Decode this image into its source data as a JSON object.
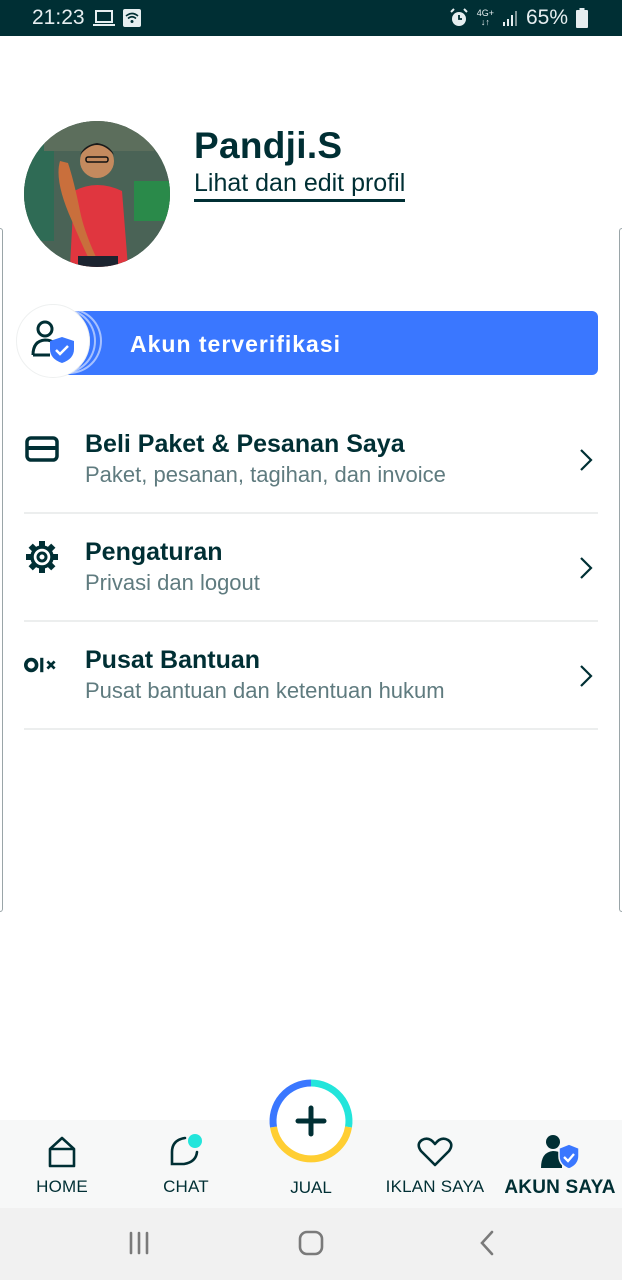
{
  "status_bar": {
    "time": "21:23",
    "battery": "65%",
    "network": "4G+",
    "icons": [
      "laptop-icon",
      "wifi-icon",
      "alarm-icon",
      "signal-icon",
      "battery-icon"
    ]
  },
  "profile": {
    "name": "Pandji.S",
    "edit_link": "Lihat dan edit profil"
  },
  "verified": {
    "label": "Akun terverifikasi",
    "color": "#3a77ff"
  },
  "menu": [
    {
      "icon": "card-icon",
      "title": "Beli Paket & Pesanan Saya",
      "subtitle": "Paket, pesanan, tagihan, dan invoice"
    },
    {
      "icon": "gear-icon",
      "title": "Pengaturan",
      "subtitle": "Privasi dan logout"
    },
    {
      "icon": "olx-logo-icon",
      "title": "Pusat Bantuan",
      "subtitle": "Pusat bantuan dan ketentuan hukum"
    }
  ],
  "bottom_nav": {
    "items": [
      {
        "icon": "home-icon",
        "label": "HOME",
        "active": false
      },
      {
        "icon": "chat-icon",
        "label": "CHAT",
        "active": false,
        "badge": true
      },
      {
        "icon": "plus-icon",
        "label": "JUAL",
        "active": false
      },
      {
        "icon": "heart-icon",
        "label": "IKLAN SAYA",
        "active": false
      },
      {
        "icon": "verified-user-icon",
        "label": "AKUN SAYA",
        "active": true
      }
    ],
    "badge_color": "#23e5db"
  },
  "colors": {
    "primary": "#002f34",
    "accent_blue": "#3a77ff",
    "accent_teal": "#23e5db",
    "accent_yellow": "#ffce32"
  }
}
